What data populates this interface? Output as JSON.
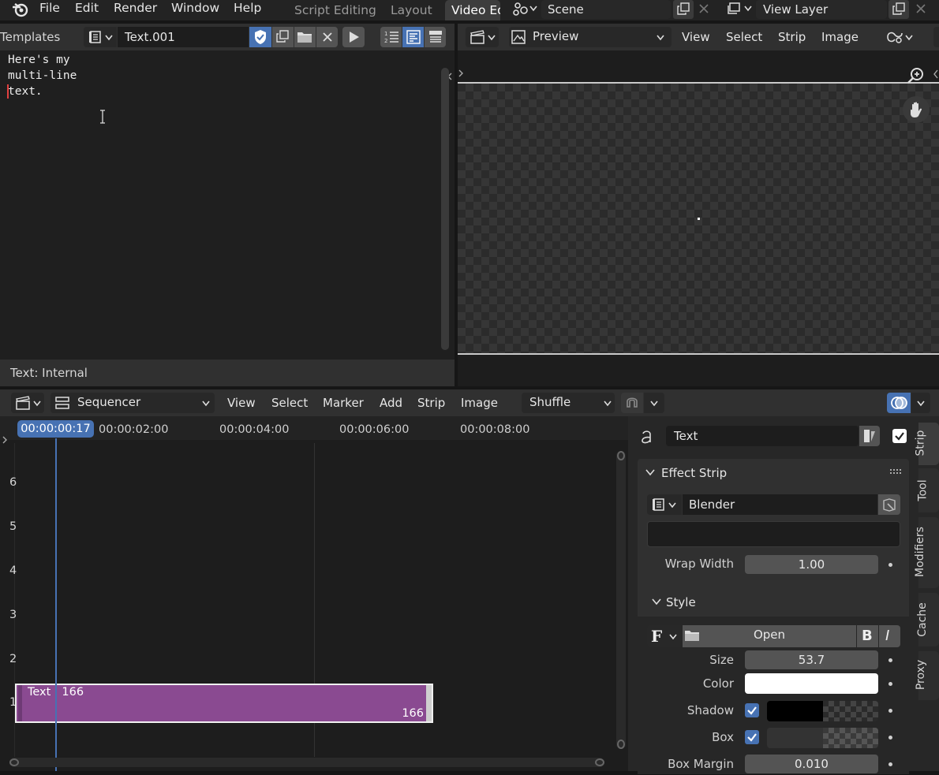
{
  "topbar": {
    "menus": [
      "File",
      "Edit",
      "Render",
      "Window",
      "Help"
    ],
    "workspace_tabs": [
      "Script Editing",
      "Layout",
      "Video Ed"
    ],
    "scene": "Scene",
    "view_layer": "View Layer"
  },
  "text_editor": {
    "templates_label": "Templates",
    "text_name": "Text.001",
    "lines": [
      "Here's my",
      "multi-line",
      "text."
    ],
    "footer": "Text: Internal"
  },
  "preview": {
    "mode": "Preview",
    "menus": [
      "View",
      "Select",
      "Strip",
      "Image"
    ]
  },
  "sequencer": {
    "mode": "Sequencer",
    "menus": [
      "View",
      "Select",
      "Marker",
      "Add",
      "Strip",
      "Image"
    ],
    "overlay_mode": "Shuffle",
    "current_time": "00:00:00:17",
    "timecodes": [
      "00:00:02:00",
      "00:00:04:00",
      "00:00:06:00",
      "00:00:08:00"
    ],
    "channels": [
      "6",
      "5",
      "4",
      "3",
      "2",
      "1"
    ],
    "strip": {
      "label": "Text | 166",
      "length": "166",
      "color": "#8a4a91"
    }
  },
  "properties": {
    "strip_name": "Text",
    "panel_effect": "Effect Strip",
    "font_name": "Blender",
    "wrap_width_label": "Wrap Width",
    "wrap_width": "1.00",
    "panel_style": "Style",
    "font_open": "Open",
    "size_label": "Size",
    "size": "53.7",
    "color_label": "Color",
    "shadow_label": "Shadow",
    "box_label": "Box",
    "box_margin_label": "Box Margin",
    "box_margin": "0.010",
    "tabs": [
      "Strip",
      "Tool",
      "Modifiers",
      "Cache",
      "Proxy"
    ]
  }
}
